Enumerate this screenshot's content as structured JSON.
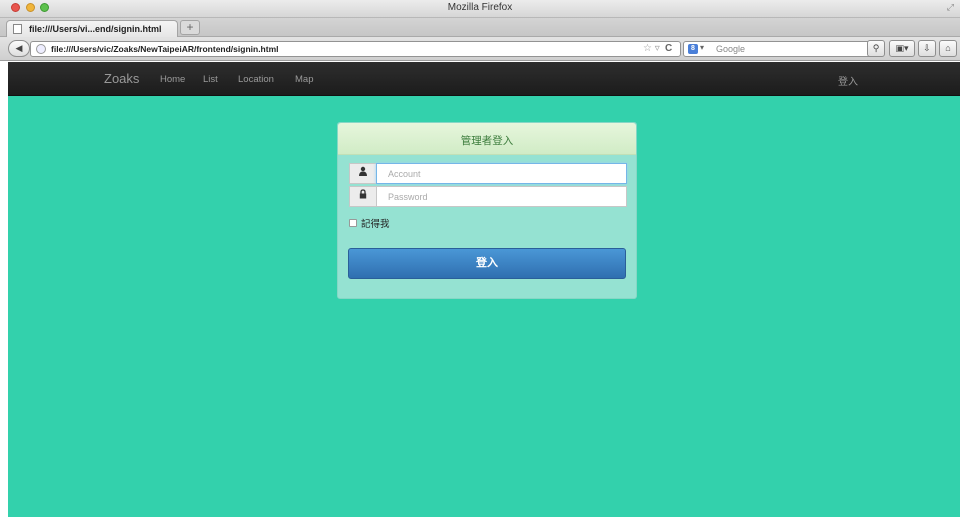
{
  "window": {
    "title": "Mozilla Firefox"
  },
  "browser": {
    "tab_title": "file:///Users/vi...end/signin.html",
    "new_tab_label": "+",
    "url": "file:///Users/vic/Zoaks/NewTaipeiAR/frontend/signin.html",
    "search_placeholder": "Google"
  },
  "site_nav": {
    "brand": "Zoaks",
    "links": [
      "Home",
      "List",
      "Location",
      "Map"
    ],
    "login_link": "登入"
  },
  "login_card": {
    "title": "管理者登入",
    "account_placeholder": "Account",
    "password_placeholder": "Password",
    "remember_label": "記得我",
    "submit_label": "登入"
  },
  "colors": {
    "page_background": "#33d1ac",
    "nav_background": "#222222",
    "card_background": "#95e2d2",
    "button": "#3a80c2"
  }
}
